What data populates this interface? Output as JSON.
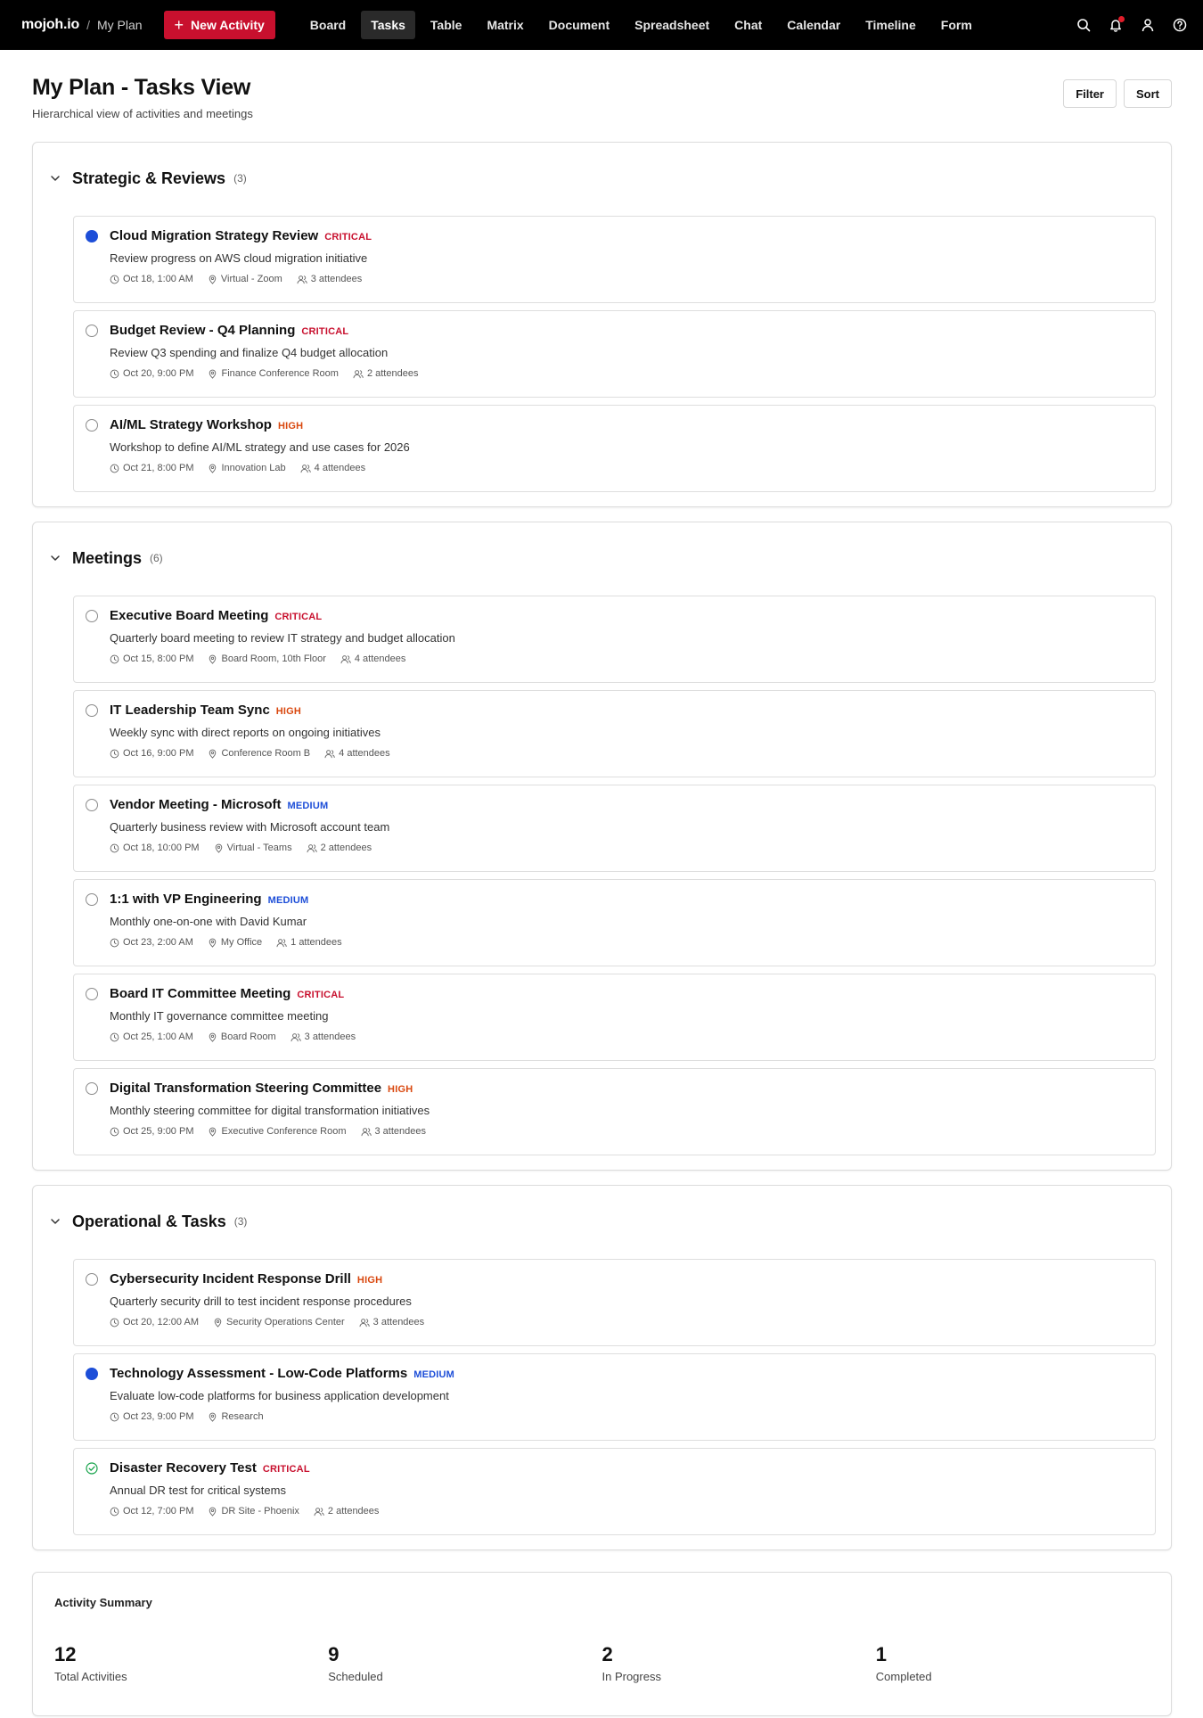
{
  "header": {
    "brand": "mojoh.io",
    "breadcrumb": "My Plan",
    "new_activity_label": "New Activity",
    "tabs": [
      {
        "label": "Board",
        "active": false
      },
      {
        "label": "Tasks",
        "active": true
      },
      {
        "label": "Table",
        "active": false
      },
      {
        "label": "Matrix",
        "active": false
      },
      {
        "label": "Document",
        "active": false
      },
      {
        "label": "Spreadsheet",
        "active": false
      },
      {
        "label": "Chat",
        "active": false
      },
      {
        "label": "Calendar",
        "active": false
      },
      {
        "label": "Timeline",
        "active": false
      },
      {
        "label": "Form",
        "active": false
      }
    ],
    "icons": [
      "search-icon",
      "bell-icon",
      "user-icon",
      "help-icon"
    ]
  },
  "page": {
    "title": "My Plan - Tasks View",
    "subtitle": "Hierarchical view of activities and meetings",
    "filter_label": "Filter",
    "sort_label": "Sort"
  },
  "colors": {
    "critical": "#c8102e",
    "high": "#d9480f",
    "medium": "#1d4ed8",
    "in_progress": "#1d4ed8",
    "completed": "#16a34a",
    "brand_button": "#c8102e"
  },
  "groups": [
    {
      "title": "Strategic & Reviews",
      "count": "(3)",
      "items": [
        {
          "status": "in_progress",
          "title": "Cloud Migration Strategy Review",
          "priority": "CRITICAL",
          "priority_level": "critical",
          "desc": "Review progress on AWS cloud migration initiative",
          "time": "Oct 18, 1:00 AM",
          "location": "Virtual - Zoom",
          "attendees": "3 attendees"
        },
        {
          "status": "todo",
          "title": "Budget Review - Q4 Planning",
          "priority": "CRITICAL",
          "priority_level": "critical",
          "desc": "Review Q3 spending and finalize Q4 budget allocation",
          "time": "Oct 20, 9:00 PM",
          "location": "Finance Conference Room",
          "attendees": "2 attendees"
        },
        {
          "status": "todo",
          "title": "AI/ML Strategy Workshop",
          "priority": "HIGH",
          "priority_level": "high",
          "desc": "Workshop to define AI/ML strategy and use cases for 2026",
          "time": "Oct 21, 8:00 PM",
          "location": "Innovation Lab",
          "attendees": "4 attendees"
        }
      ]
    },
    {
      "title": "Meetings",
      "count": "(6)",
      "items": [
        {
          "status": "todo",
          "title": "Executive Board Meeting",
          "priority": "CRITICAL",
          "priority_level": "critical",
          "desc": "Quarterly board meeting to review IT strategy and budget allocation",
          "time": "Oct 15, 8:00 PM",
          "location": "Board Room, 10th Floor",
          "attendees": "4 attendees"
        },
        {
          "status": "todo",
          "title": "IT Leadership Team Sync",
          "priority": "HIGH",
          "priority_level": "high",
          "desc": "Weekly sync with direct reports on ongoing initiatives",
          "time": "Oct 16, 9:00 PM",
          "location": "Conference Room B",
          "attendees": "4 attendees"
        },
        {
          "status": "todo",
          "title": "Vendor Meeting - Microsoft",
          "priority": "MEDIUM",
          "priority_level": "medium",
          "desc": "Quarterly business review with Microsoft account team",
          "time": "Oct 18, 10:00 PM",
          "location": "Virtual - Teams",
          "attendees": "2 attendees"
        },
        {
          "status": "todo",
          "title": "1:1 with VP Engineering",
          "priority": "MEDIUM",
          "priority_level": "medium",
          "desc": "Monthly one-on-one with David Kumar",
          "time": "Oct 23, 2:00 AM",
          "location": "My Office",
          "attendees": "1 attendees"
        },
        {
          "status": "todo",
          "title": "Board IT Committee Meeting",
          "priority": "CRITICAL",
          "priority_level": "critical",
          "desc": "Monthly IT governance committee meeting",
          "time": "Oct 25, 1:00 AM",
          "location": "Board Room",
          "attendees": "3 attendees"
        },
        {
          "status": "todo",
          "title": "Digital Transformation Steering Committee",
          "priority": "HIGH",
          "priority_level": "high",
          "desc": "Monthly steering committee for digital transformation initiatives",
          "time": "Oct 25, 9:00 PM",
          "location": "Executive Conference Room",
          "attendees": "3 attendees"
        }
      ]
    },
    {
      "title": "Operational & Tasks",
      "count": "(3)",
      "items": [
        {
          "status": "todo",
          "title": "Cybersecurity Incident Response Drill",
          "priority": "HIGH",
          "priority_level": "high",
          "desc": "Quarterly security drill to test incident response procedures",
          "time": "Oct 20, 12:00 AM",
          "location": "Security Operations Center",
          "attendees": "3 attendees"
        },
        {
          "status": "in_progress",
          "title": "Technology Assessment - Low-Code Platforms",
          "priority": "MEDIUM",
          "priority_level": "medium",
          "desc": "Evaluate low-code platforms for business application development",
          "time": "Oct 23, 9:00 PM",
          "location": "Research",
          "attendees": ""
        },
        {
          "status": "completed",
          "title": "Disaster Recovery Test",
          "priority": "CRITICAL",
          "priority_level": "critical",
          "desc": "Annual DR test for critical systems",
          "time": "Oct 12, 7:00 PM",
          "location": "DR Site - Phoenix",
          "attendees": "2 attendees"
        }
      ]
    }
  ],
  "summary": {
    "title": "Activity Summary",
    "stats": [
      {
        "value": "12",
        "label": "Total Activities"
      },
      {
        "value": "9",
        "label": "Scheduled"
      },
      {
        "value": "2",
        "label": "In Progress"
      },
      {
        "value": "1",
        "label": "Completed"
      }
    ]
  }
}
